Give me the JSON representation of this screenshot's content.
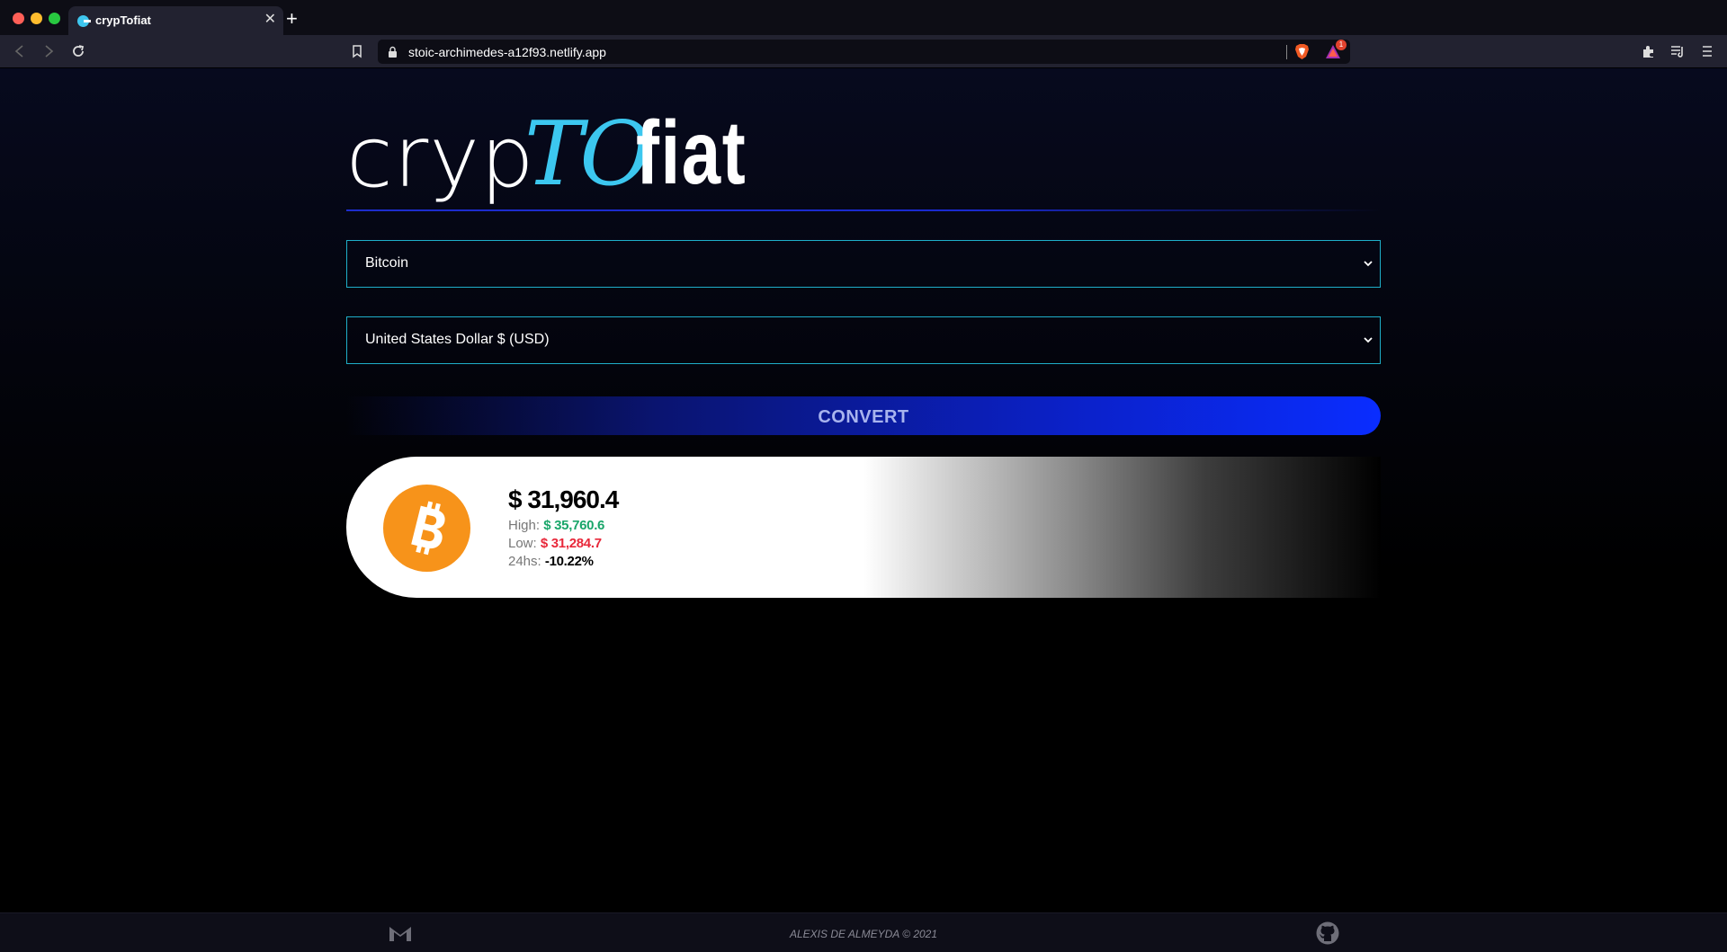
{
  "browser": {
    "tab_title": "crypTofiat",
    "url": "stoic-archimedes-a12f93.netlify.app",
    "rewards_badge": "1"
  },
  "logo": {
    "part1": "cryp",
    "part2": "TO",
    "part3": "fiat"
  },
  "form": {
    "crypto_select": "Bitcoin",
    "currency_select": "United States Dollar $ (USD)",
    "convert_label": "CONVERT"
  },
  "result": {
    "price": "$ 31,960.4",
    "high_label": "High:",
    "high_value": "$ 35,760.6",
    "low_label": "Low:",
    "low_value": "$ 31,284.7",
    "change_label": "24hs:",
    "change_value": "-10.22%"
  },
  "footer": {
    "credit": "ALEXIS DE ALMEYDA © 2021"
  },
  "colors": {
    "accent": "#3cc7ef",
    "button": "#0a2dff",
    "high": "#1aa66a",
    "low": "#e8283a",
    "coin": "#f7931a"
  }
}
